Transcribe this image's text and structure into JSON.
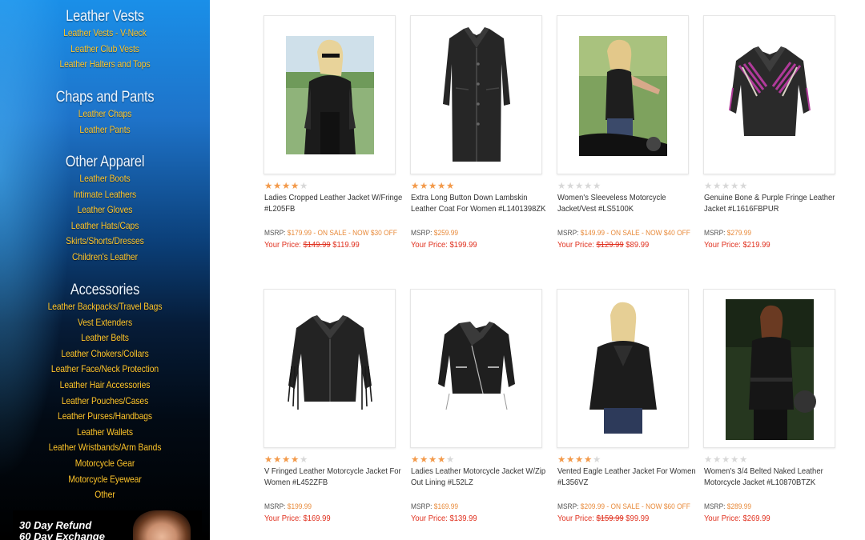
{
  "sidebar": {
    "sections": [
      {
        "heading": "Leather Vests",
        "links": [
          "Leather Vests - V-Neck",
          "Leather Club Vests",
          "Leather Halters and Tops"
        ]
      },
      {
        "heading": "Chaps and Pants",
        "links": [
          "Leather Chaps",
          "Leather Pants"
        ]
      },
      {
        "heading": "Other Apparel",
        "links": [
          "Leather Boots",
          "Intimate Leathers",
          "Leather Gloves",
          "Leather Hats/Caps",
          "Skirts/Shorts/Dresses",
          "Children's Leather"
        ]
      },
      {
        "heading": "Accessories",
        "links": [
          "Leather Backpacks/Travel Bags",
          "Vest Extenders",
          "Leather Belts",
          "Leather Chokers/Collars",
          "Leather Face/Neck Protection",
          "Leather Hair Accessories",
          "Leather Pouches/Cases",
          "Leather Purses/Handbags",
          "Leather Wallets",
          "Leather Wristbands/Arm Bands",
          "Motorcycle Gear",
          "Motorcycle Eyewear",
          "Other"
        ]
      }
    ],
    "promo": {
      "line1": "30 Day Refund",
      "line2": "60 Day Exchange"
    }
  },
  "labels": {
    "msrp": "MSRP: ",
    "your_price": "Your Price: "
  },
  "colors": {
    "star_on": "#f39a4b",
    "star_off": "#d8d8d8",
    "sale_red": "#e0301e",
    "msrp_orange": "#e88a3a",
    "link_gold": "#ffc62b"
  },
  "products": [
    {
      "title": "Ladies Cropped Leather Jacket W/Fringe #L205FB",
      "rating": 4,
      "msrp": "$179.99 - ON SALE - NOW $30 OFF",
      "was": "$149.99",
      "price": "$119.99",
      "image": "woman-fringe-jacket-photo"
    },
    {
      "title": "Extra Long Button Down Lambskin Leather Coat For Women #L1401398ZK",
      "rating": 5,
      "msrp": "$259.99",
      "was": "",
      "price": "$199.99",
      "image": "long-leather-coat"
    },
    {
      "title": "Women's Sleeveless Motorcycle Jacket/Vest #LS5100K",
      "rating": 0,
      "msrp": "$149.99 - ON SALE - NOW $40 OFF",
      "was": "$129.99",
      "price": "$89.99",
      "image": "woman-vest-motorcycle-photo"
    },
    {
      "title": "Genuine Bone & Purple Fringe Leather Jacket #L1616FBPUR",
      "rating": 0,
      "msrp": "$279.99",
      "was": "",
      "price": "$219.99",
      "image": "purple-fringe-jacket"
    },
    {
      "title": "V Fringed Leather Motorcycle Jacket For Women #L452ZFB",
      "rating": 4,
      "msrp": "$199.99",
      "was": "",
      "price": "$169.99",
      "image": "fringed-motorcycle-jacket"
    },
    {
      "title": "Ladies Leather Motorcycle Jacket W/Zip Out Lining #L52LZ",
      "rating": 4,
      "msrp": "$169.99",
      "was": "",
      "price": "$139.99",
      "image": "zip-motorcycle-jacket"
    },
    {
      "title": "Vented Eagle Leather Jacket For Women #L356VZ",
      "rating": 4,
      "msrp": "$209.99 - ON SALE - NOW $60 OFF",
      "was": "$159.99",
      "price": "$99.99",
      "image": "woman-eagle-jacket-photo"
    },
    {
      "title": "Women's 3/4 Belted Naked Leather Motorcycle Jacket #L10870BTZK",
      "rating": 0,
      "msrp": "$289.99",
      "was": "",
      "price": "$269.99",
      "image": "woman-belted-jacket-photo"
    }
  ]
}
